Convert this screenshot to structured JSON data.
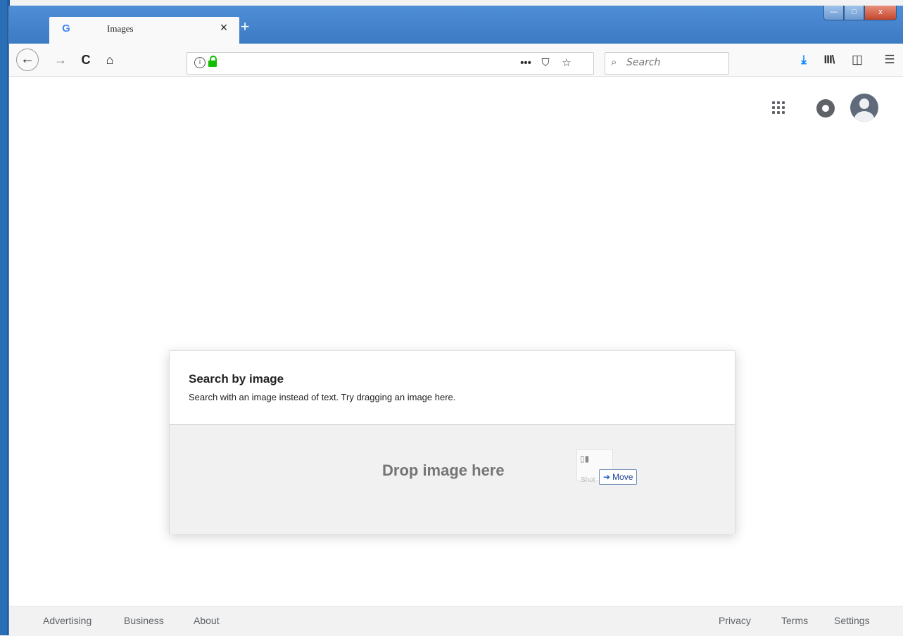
{
  "browser": {
    "tab": {
      "favicon": "G",
      "title": "Images",
      "close": "×"
    },
    "new_tab": "+",
    "window_controls": {
      "minimize": "—",
      "maximize": "□",
      "close": "x"
    },
    "nav": {
      "back": "←",
      "forward": "→",
      "reload": "C",
      "home": "⌂"
    },
    "urlbar": {
      "info": "i",
      "more": "•••",
      "pocket": "⛉",
      "bookmark": "☆"
    },
    "searchbar": {
      "placeholder": "Search",
      "glass": "⌕"
    },
    "toolbar": {
      "download": "⤓",
      "library": "III\\",
      "sidebar": "◫",
      "menu": "☰"
    }
  },
  "page": {
    "dialog": {
      "title": "Search by image",
      "description": "Search with an image instead of text. Try dragging an image here.",
      "drop_text": "Drop image here",
      "drag_ghost_label": "Shot",
      "move_tooltip": "Move"
    },
    "footer": {
      "left": [
        "Advertising",
        "Business",
        "About"
      ],
      "right": [
        "Privacy",
        "Terms",
        "Settings"
      ]
    }
  },
  "colors": {
    "accent": "#0a84ff",
    "secure": "#12bc00",
    "titlebar": "#3c7ac4"
  }
}
